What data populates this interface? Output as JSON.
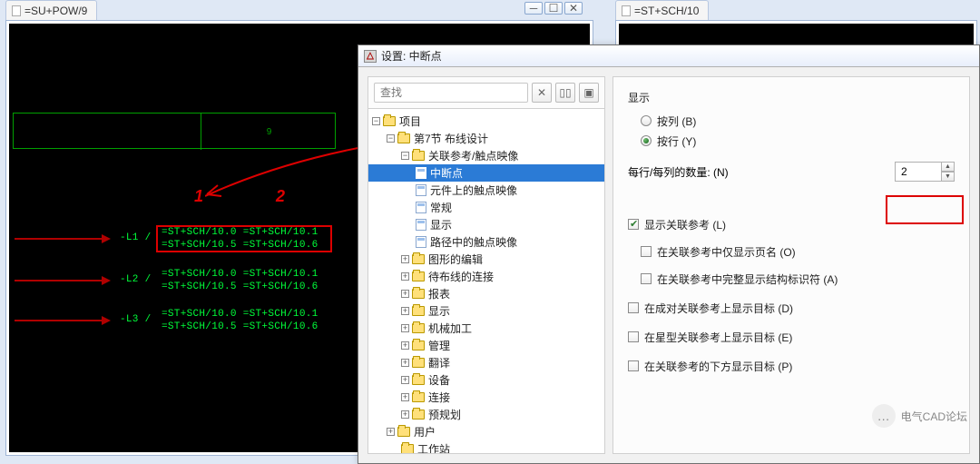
{
  "tabs": {
    "left": "=SU+POW/9",
    "right": "=ST+SCH/10"
  },
  "windowButtons": {
    "min": "─",
    "max": "☐",
    "close": "✕"
  },
  "canvas": {
    "header_cell": "9",
    "anno1": "1",
    "anno2": "2",
    "bus1": "-L1 /",
    "bus2": "-L2 /",
    "bus3": "-L3 /",
    "row1a": "=ST+SCH/10.0 =ST+SCH/10.1",
    "row1b": "=ST+SCH/10.5 =ST+SCH/10.6",
    "row2a": "=ST+SCH/10.0 =ST+SCH/10.1",
    "row2b": "=ST+SCH/10.5 =ST+SCH/10.6",
    "row3a": "=ST+SCH/10.0 =ST+SCH/10.1",
    "row3b": "=ST+SCH/10.5 =ST+SCH/10.6"
  },
  "dialog": {
    "title": "设置: 中断点",
    "search_placeholder": "查找",
    "search_clear": "✕",
    "search_opt1": "▯▯",
    "search_opt2": "▣"
  },
  "tree": {
    "n0": "项目",
    "n1": "第7节 布线设计",
    "n2": "关联参考/触点映像",
    "n3": "中断点",
    "n4": "元件上的触点映像",
    "n5": "常规",
    "n6": "显示",
    "n7": "路径中的触点映像",
    "n8": "图形的编辑",
    "n9": "待布线的连接",
    "n10": "报表",
    "n11": "显示",
    "n12": "机械加工",
    "n13": "管理",
    "n14": "翻译",
    "n15": "设备",
    "n16": "连接",
    "n17": "预规划",
    "n18": "用户",
    "n19": "工作站"
  },
  "right": {
    "section_display": "显示",
    "radio_col": "按列 (B)",
    "radio_row": "按行 (Y)",
    "count_label": "每行/每列的数量: (N)",
    "count_value": "2",
    "chk_showref": "显示关联参考 (L)",
    "chk_pagename": "在关联参考中仅显示页名 (O)",
    "chk_fullstruct": "在关联参考中完整显示结构标识符 (A)",
    "chk_pair_target": "在成对关联参考上显示目标 (D)",
    "chk_star_target": "在星型关联参考上显示目标 (E)",
    "chk_below_target": "在关联参考的下方显示目标 (P)"
  },
  "watermark": {
    "text": "电气CAD论坛",
    "icon": "…"
  }
}
